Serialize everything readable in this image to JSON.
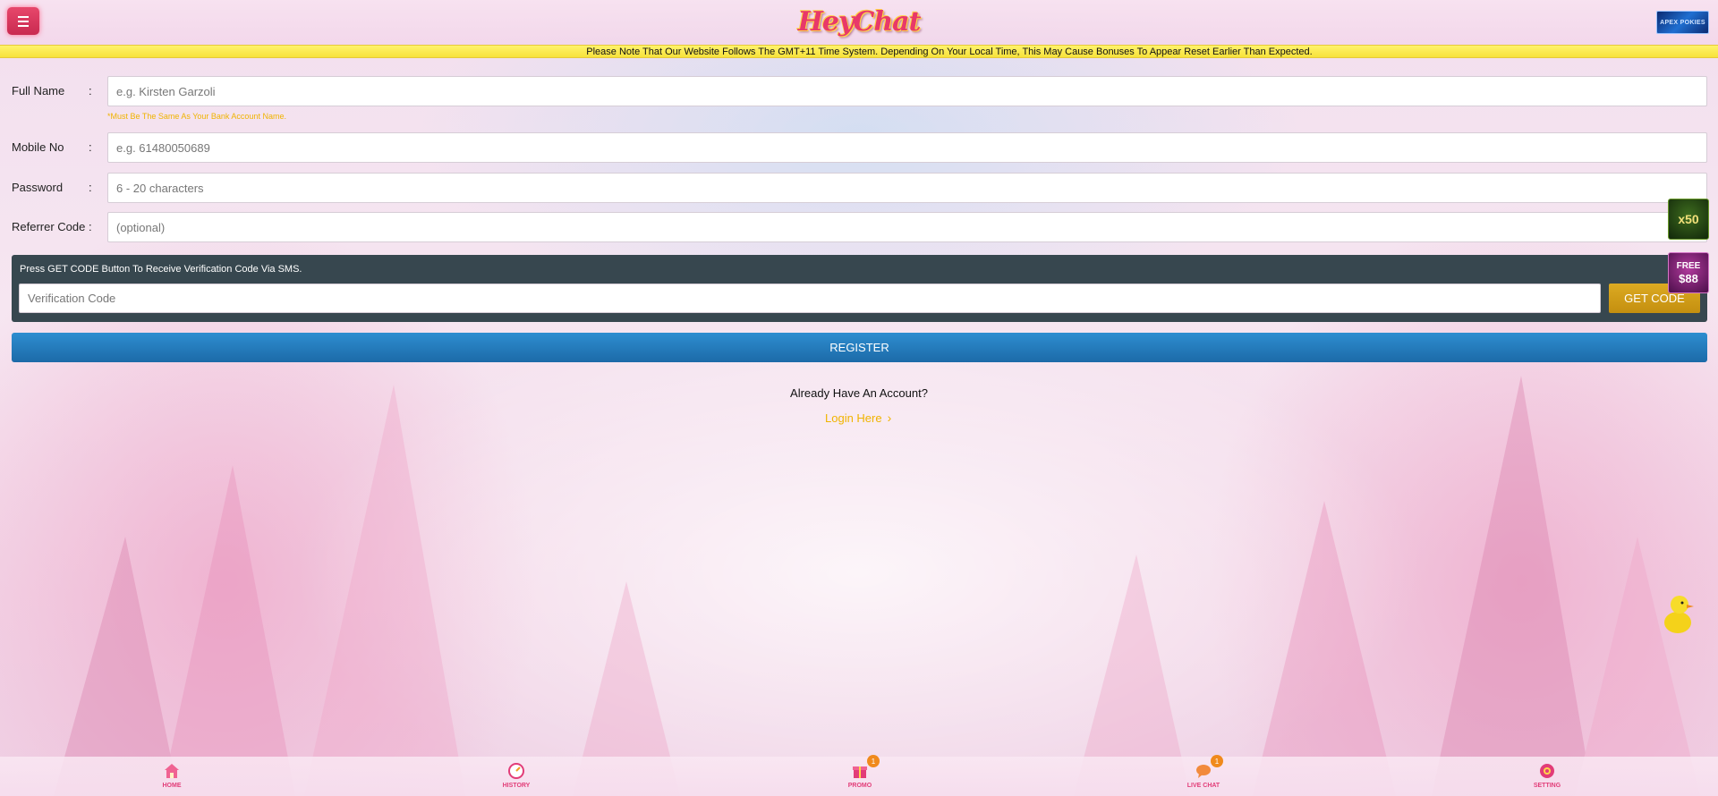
{
  "header": {
    "logo_text": "HeyChat",
    "partner_badge": "APEX POKIES"
  },
  "notice": "Please Note That Our Website Follows The GMT+11 Time System. Depending On Your Local Time, This May Cause Bonuses To Appear Reset Earlier Than Expected.",
  "form": {
    "full_name": {
      "label": "Full Name",
      "colon": ":",
      "placeholder": "e.g. Kirsten Garzoli",
      "value": "",
      "hint": "*Must Be The Same As Your Bank Account Name."
    },
    "mobile": {
      "label": "Mobile No",
      "colon": ":",
      "placeholder": "e.g. 61480050689",
      "value": ""
    },
    "password": {
      "label": "Password",
      "colon": ":",
      "placeholder": "6 - 20 characters",
      "value": ""
    },
    "referrer": {
      "label": "Referrer Code",
      "colon": ":",
      "placeholder": "(optional)",
      "value": ""
    }
  },
  "verification": {
    "note": "Press GET CODE Button To Receive Verification Code Via SMS.",
    "placeholder": "Verification Code",
    "get_code_label": "GET CODE"
  },
  "register_label": "REGISTER",
  "account": {
    "question": "Already Have An Account?",
    "login_label": "Login Here"
  },
  "floating": {
    "promo1_text": "x50",
    "promo2_line1": "FREE",
    "promo2_line2": "$88"
  },
  "bottom_nav": [
    {
      "label": "HOME",
      "icon": "home-icon",
      "badge": ""
    },
    {
      "label": "HISTORY",
      "icon": "history-icon",
      "badge": ""
    },
    {
      "label": "PROMO",
      "icon": "gift-icon",
      "badge": "1"
    },
    {
      "label": "LIVE CHAT",
      "icon": "chat-icon",
      "badge": "1"
    },
    {
      "label": "SETTING",
      "icon": "gear-icon",
      "badge": ""
    }
  ],
  "colors": {
    "accent_pink": "#e23c78",
    "notice_yellow": "#f7e23a",
    "register_blue": "#1c6aa8",
    "get_code_gold": "#c48f0f",
    "verify_panel": "#37474f",
    "hint_gold": "#f0b400"
  }
}
